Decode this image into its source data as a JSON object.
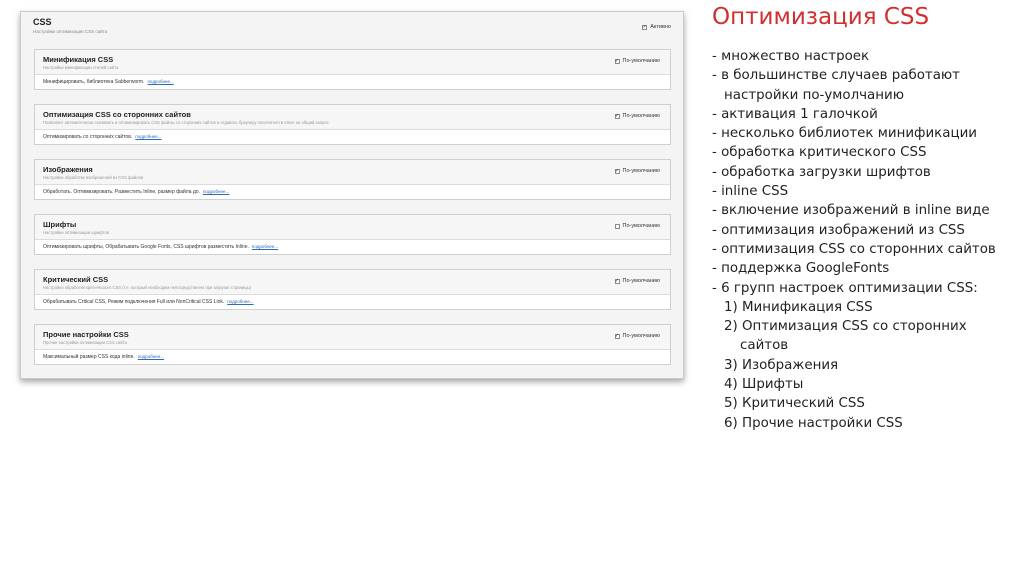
{
  "screenshot": {
    "title": "CSS",
    "subtitle": "Настройки оптимизации CSS сайта",
    "active_label": "Активно",
    "active_checked": true,
    "groups": [
      {
        "title": "Минификация CSS",
        "subtitle": "Настройки минификации стилей сайта",
        "default_label": "По-умолчанию",
        "checked": true,
        "body": "Минифицировать, библиотека Sabberworm.",
        "link": "подробнее..."
      },
      {
        "title": "Оптимизация CSS со сторонних сайтов",
        "subtitle": "Позволяет автоматически скачивать и оптимизировать CSS файлы со сторонних сайтов и отдавать браузеру посетителя в ответ на общий запрос",
        "default_label": "По-умолчанию",
        "checked": true,
        "body": "Оптимизировать со сторонних сайтов.",
        "link": "подробнее..."
      },
      {
        "title": "Изображения",
        "subtitle": "Настройки обработки изображений из CSS файлов",
        "default_label": "По-умолчанию",
        "checked": true,
        "body": "Обработать. Оптимизировать. Разместить Inline, размер файла до.",
        "link": "подробнее..."
      },
      {
        "title": "Шрифты",
        "subtitle": "Настройки оптимизации шрифтов",
        "default_label": "По-умолчанию",
        "checked": false,
        "body": "Оптимизировать шрифты, Обрабатывать Google Fonts, CSS шрифтов разместить Inline.",
        "link": "подробнее..."
      },
      {
        "title": "Критический CSS",
        "subtitle": "Настройки обработки критического CSS (т.е. который необходим непосредственно при загрузке страницы)",
        "default_label": "По-умолчанию",
        "checked": true,
        "body": "Обрабатывать Critical CSS, Режим подключения Full или NonCritical CSS Link.",
        "link": "подробнее..."
      },
      {
        "title": "Прочие настройки CSS",
        "subtitle": "Прочие настройки оптимизации CSS сайта",
        "default_label": "По-умолчанию",
        "checked": true,
        "body": "Максимальный размер CSS кода inline.",
        "link": "подробнее..."
      }
    ]
  },
  "slide": {
    "title": "Оптимизация CSS",
    "title_color": "#d32f2f",
    "bullets": [
      "- множество настроек",
      "- в большинстве случаев работают",
      "настройки по-умолчанию",
      "- активация 1 галочкой",
      "- несколько библиотек минификации",
      "- обработка критического CSS",
      "- обработка загрузки шрифтов",
      "- inline CSS",
      "- включение изображений в inline виде",
      "- оптимизация изображений из CSS",
      "- оптимизация CSS со сторонних сайтов",
      "- поддержка GoogleFonts",
      "- 6 групп настроек оптимизации CSS:",
      "1) Минификация CSS",
      "2) Оптимизация CSS со сторонних",
      "сайтов",
      "3) Изображения",
      "4) Шрифты",
      "5) Критический CSS",
      "6) Прочие настройки CSS"
    ]
  }
}
